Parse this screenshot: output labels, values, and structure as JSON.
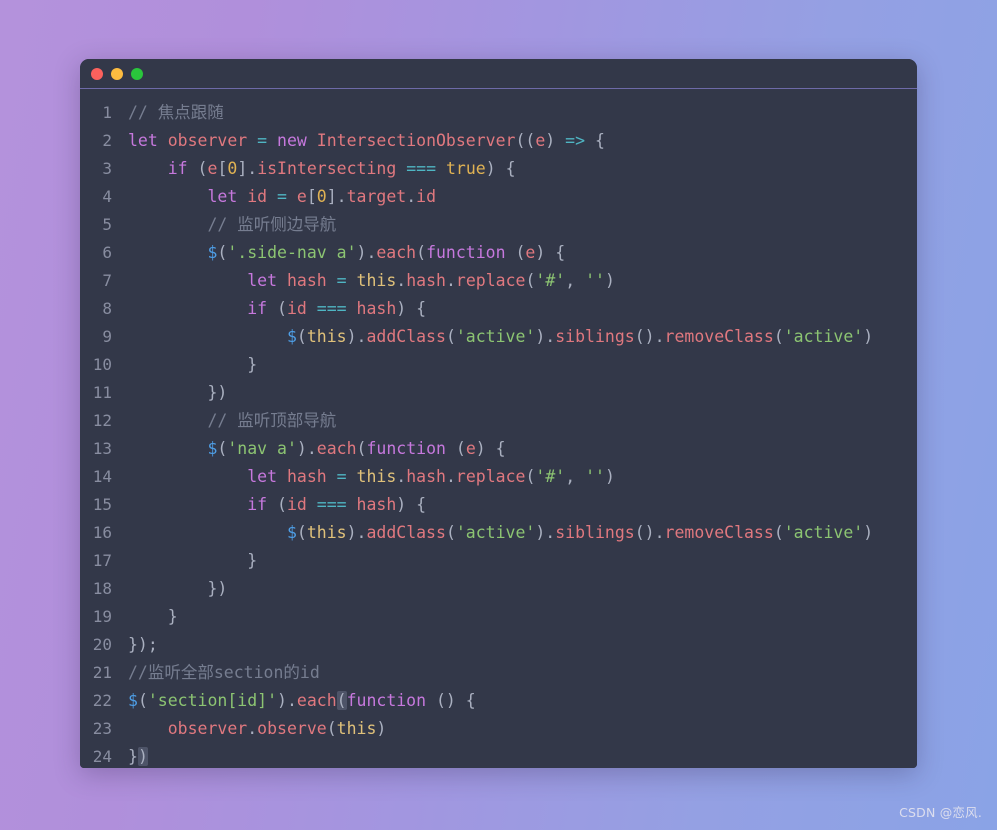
{
  "window": {
    "controls": [
      {
        "name": "close",
        "color": "#fc615d"
      },
      {
        "name": "minimize",
        "color": "#fdbc40"
      },
      {
        "name": "maximize",
        "color": "#2ac63c"
      }
    ],
    "background_color": "#333849",
    "accent_border": "#6e6aa8"
  },
  "theme": {
    "page_gradient_start": "#b492dc",
    "page_gradient_end": "#8aa3e6",
    "comment": "#767d90",
    "keyword": "#c678dd",
    "identifier": "#e0787f",
    "operator": "#4fb6c4",
    "number": "#e0b253",
    "this": "#e0c17a",
    "string": "#8cc472",
    "punctuation": "#aab0c0",
    "jquery_dollar": "#4e9ee6",
    "line_number": "#888da0",
    "bracket_highlight": "#4e5468"
  },
  "editor": {
    "language": "javascript",
    "total_lines": 24,
    "lines": [
      {
        "num": "1",
        "text": "// 焦点跟随"
      },
      {
        "num": "2",
        "text": "let observer = new IntersectionObserver((e) => {"
      },
      {
        "num": "3",
        "text": "    if (e[0].isIntersecting === true) {"
      },
      {
        "num": "4",
        "text": "        let id = e[0].target.id"
      },
      {
        "num": "5",
        "text": "        // 监听侧边导航"
      },
      {
        "num": "6",
        "text": "        $('.side-nav a').each(function (e) {"
      },
      {
        "num": "7",
        "text": "            let hash = this.hash.replace('#', '')"
      },
      {
        "num": "8",
        "text": "            if (id === hash) {"
      },
      {
        "num": "9",
        "text": "                $(this).addClass('active').siblings().removeClass('active')"
      },
      {
        "num": "10",
        "text": "            }"
      },
      {
        "num": "11",
        "text": "        })"
      },
      {
        "num": "12",
        "text": "        // 监听顶部导航"
      },
      {
        "num": "13",
        "text": "        $('nav a').each(function (e) {"
      },
      {
        "num": "14",
        "text": "            let hash = this.hash.replace('#', '')"
      },
      {
        "num": "15",
        "text": "            if (id === hash) {"
      },
      {
        "num": "16",
        "text": "                $(this).addClass('active').siblings().removeClass('active')"
      },
      {
        "num": "17",
        "text": "            }"
      },
      {
        "num": "18",
        "text": "        })"
      },
      {
        "num": "19",
        "text": "    }"
      },
      {
        "num": "20",
        "text": "});"
      },
      {
        "num": "21",
        "text": "//监听全部section的id"
      },
      {
        "num": "22",
        "text": "$('section[id]').each(function () {"
      },
      {
        "num": "23",
        "text": "    observer.observe(this)"
      },
      {
        "num": "24",
        "text": "})"
      }
    ]
  },
  "watermark": {
    "text": "CSDN @恋风."
  }
}
